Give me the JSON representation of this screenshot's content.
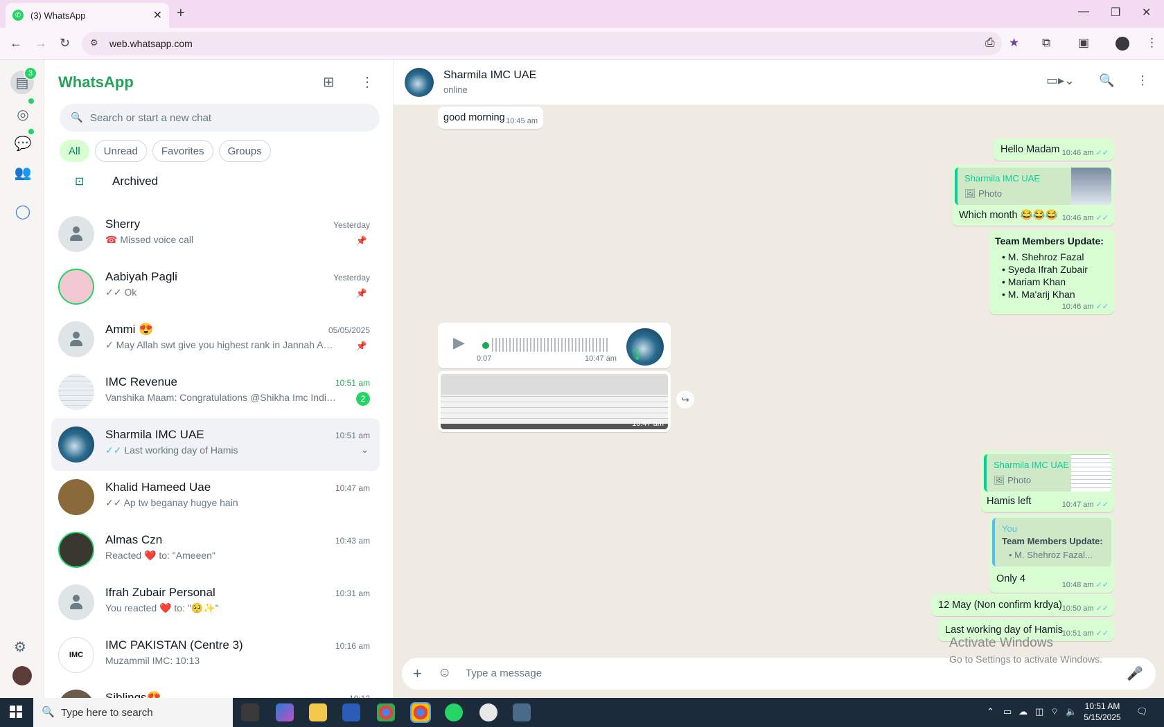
{
  "browser": {
    "tab_title": "(3) WhatsApp",
    "url": "web.whatsapp.com"
  },
  "rail": {
    "chats_badge": "3"
  },
  "sidebar": {
    "brand": "WhatsApp",
    "search_placeholder": "Search or start a new chat",
    "filters": [
      "All",
      "Unread",
      "Favorites",
      "Groups"
    ],
    "archived_label": "Archived",
    "chats": [
      {
        "name": "Sherry",
        "message": "Missed voice call",
        "time": "Yesterday",
        "prefix": "☎",
        "pinned": true
      },
      {
        "name": "Aabiyah Pagli",
        "message": "Ok",
        "time": "Yesterday",
        "prefix": "✓✓",
        "pinned": true
      },
      {
        "name": "Ammi 😍",
        "message": "May Allah swt give you highest rank in Jannah  Ame...",
        "time": "05/05/2025",
        "prefix": "✓",
        "pinned": true
      },
      {
        "name": "IMC Revenue",
        "message": "Vanshika Maam: Congratulations @Shikha Imc India 🎉",
        "time": "10:51 am",
        "unread": "2"
      },
      {
        "name": "Sharmila IMC UAE",
        "message": "Last working day of Hamis",
        "time": "10:51 am",
        "prefix": "✓✓"
      },
      {
        "name": "Khalid Hameed Uae",
        "message": "Ap tw beganay hugye hain",
        "time": "10:47 am",
        "prefix": "✓✓"
      },
      {
        "name": "Almas Czn",
        "message": "Reacted ❤️ to: \"Ameeen\"",
        "time": "10:43 am"
      },
      {
        "name": "Ifrah Zubair Personal",
        "message": "You reacted ❤️ to: \"🥺✨\"",
        "time": "10:31 am"
      },
      {
        "name": "IMC PAKISTAN (Centre 3)",
        "message": "Muzammil IMC: 10:13",
        "time": "10:16 am"
      },
      {
        "name": "Siblings😍",
        "message": "",
        "time": "10:13"
      }
    ]
  },
  "conversation": {
    "contact_name": "Sharmila IMC UAE",
    "status": "online",
    "messages": {
      "m1": {
        "text": "good morning",
        "time": "10:45 am"
      },
      "m2": {
        "text": "Hello Madam",
        "time": "10:46 am"
      },
      "m3": {
        "quote_name": "Sharmila IMC UAE",
        "quote_type": "Photo",
        "text": "Which month 😂😂😂",
        "time": "10:46 am"
      },
      "m4": {
        "title": "Team Members Update:",
        "items": [
          "M. Shehroz Fazal",
          "Syeda Ifrah Zubair",
          "Mariam Khan",
          "M. Ma'arij Khan"
        ],
        "time": "10:46 am"
      },
      "voice": {
        "duration": "0:07",
        "time": "10:47 am"
      },
      "photo": {
        "time": "10:47 am"
      },
      "m5": {
        "quote_name": "Sharmila IMC UAE",
        "quote_type": "Photo",
        "text": "Hamis left",
        "time": "10:47 am"
      },
      "m6": {
        "quote_name": "You",
        "quote_title": "Team Members Update:",
        "quote_line": "•  M. Shehroz Fazal...",
        "text": "Only 4",
        "time": "10:48 am"
      },
      "m7": {
        "text": "12 May (Non confirm krdya)",
        "time": "10:50 am"
      },
      "m8": {
        "text": "Last working day of Hamis",
        "time": "10:51 am"
      }
    },
    "composer_placeholder": "Type a message"
  },
  "watermark": {
    "line1": "Activate Windows",
    "line2": "Go to Settings to activate Windows."
  },
  "taskbar": {
    "search_placeholder": "Type here to search",
    "time": "10:51 AM",
    "date": "5/15/2025"
  }
}
